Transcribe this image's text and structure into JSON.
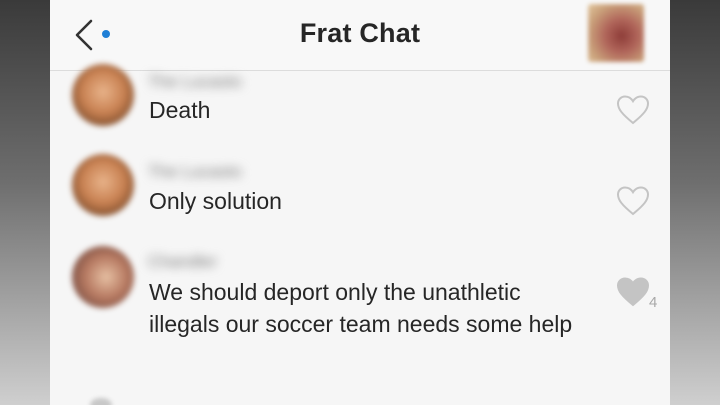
{
  "header": {
    "title": "Frat Chat",
    "back_icon": "chevron-left-icon",
    "unread_color": "#1f7fd6"
  },
  "messages": [
    {
      "sender": "The Lucasto",
      "text": "Death",
      "liked": false,
      "likes": ""
    },
    {
      "sender": "The Lucasto",
      "text": "Only solution",
      "liked": false,
      "likes": ""
    },
    {
      "sender": "Chandler",
      "text": "We should deport only the unathletic illegals our soccer team needs some help",
      "liked": true,
      "likes": "4"
    }
  ],
  "colors": {
    "heart_outline": "#c4c4c4",
    "heart_filled": "#c4c4c4",
    "text": "#262626"
  }
}
